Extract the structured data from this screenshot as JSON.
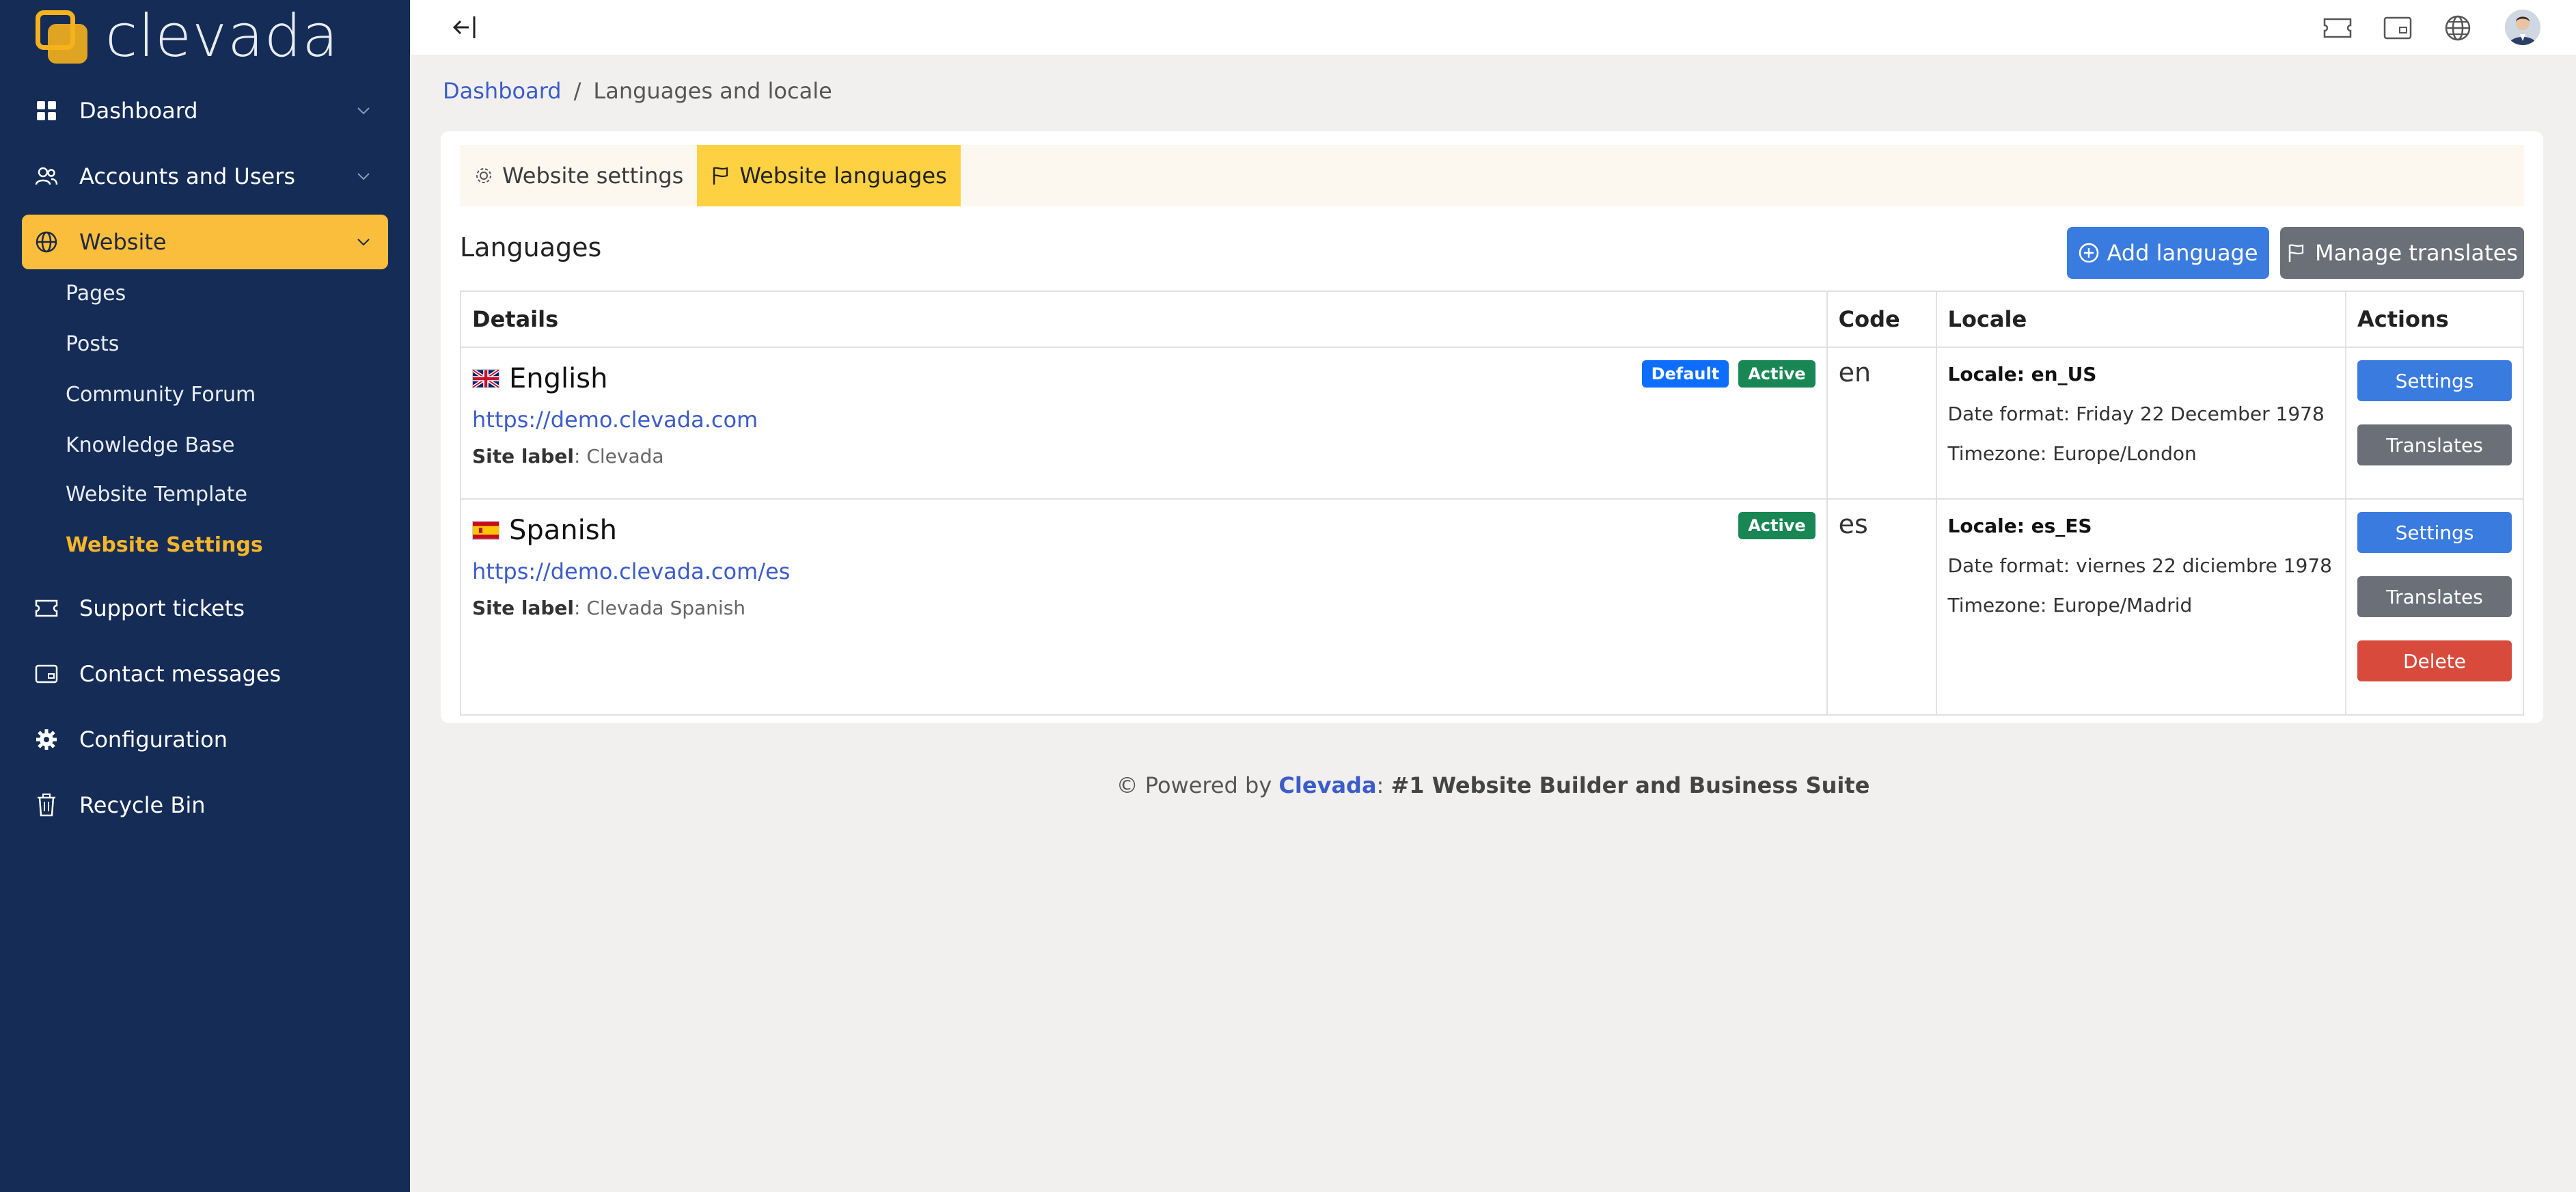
{
  "brand": {
    "name": "clevada",
    "accent": "#fbbd3c",
    "sidebar_bg": "#142c56"
  },
  "sidebar": {
    "items": [
      {
        "label": "Dashboard",
        "icon": "grid-icon",
        "expandable": true
      },
      {
        "label": "Accounts and Users",
        "icon": "users-icon",
        "expandable": true
      },
      {
        "label": "Website",
        "icon": "globe-icon",
        "expandable": true,
        "active": true
      },
      {
        "label": "Support tickets",
        "icon": "ticket-icon"
      },
      {
        "label": "Contact messages",
        "icon": "mail-icon"
      },
      {
        "label": "Configuration",
        "icon": "gear-icon"
      },
      {
        "label": "Recycle Bin",
        "icon": "trash-icon"
      }
    ],
    "website_subitems": [
      {
        "label": "Pages"
      },
      {
        "label": "Posts"
      },
      {
        "label": "Community Forum"
      },
      {
        "label": "Knowledge Base"
      },
      {
        "label": "Website Template"
      },
      {
        "label": "Website Settings",
        "current": true
      }
    ]
  },
  "topbar": {
    "icons": [
      "back-arrow-icon",
      "ticket-icon",
      "mail-icon",
      "globe-icon",
      "avatar"
    ]
  },
  "breadcrumb": {
    "root": "Dashboard",
    "separator": "/",
    "current": "Languages and locale"
  },
  "tabs": [
    {
      "label": "Website settings",
      "icon": "gear-icon"
    },
    {
      "label": "Website languages",
      "icon": "flag-icon",
      "active": true
    }
  ],
  "section": {
    "title": "Languages",
    "add_button": "Add language",
    "manage_button": "Manage translates"
  },
  "table": {
    "headers": {
      "details": "Details",
      "code": "Code",
      "locale": "Locale",
      "actions": "Actions"
    },
    "rows": [
      {
        "name": "English",
        "flag": "uk-flag-icon",
        "url": "https://demo.clevada.com",
        "site_label_key": "Site label",
        "site_label_value": ": Clevada",
        "badges": {
          "default": "Default",
          "active": "Active"
        },
        "code": "en",
        "locale": "Locale: en_US",
        "date_format": "Date format: Friday 22 December 1978",
        "timezone": "Timezone: Europe/London",
        "actions": {
          "settings": "Settings",
          "translates": "Translates"
        }
      },
      {
        "name": "Spanish",
        "flag": "es-flag-icon",
        "url": "https://demo.clevada.com/es",
        "site_label_key": "Site label",
        "site_label_value": ": Clevada Spanish",
        "badges": {
          "active": "Active"
        },
        "code": "es",
        "locale": "Locale: es_ES",
        "date_format": "Date format: viernes 22 diciembre 1978",
        "timezone": "Timezone: Europe/Madrid",
        "actions": {
          "settings": "Settings",
          "translates": "Translates",
          "delete": "Delete"
        }
      }
    ]
  },
  "footer": {
    "prefix": "© Powered by ",
    "brand": "Clevada",
    "suffix": ": ",
    "tagline": "#1 Website Builder and Business Suite"
  }
}
